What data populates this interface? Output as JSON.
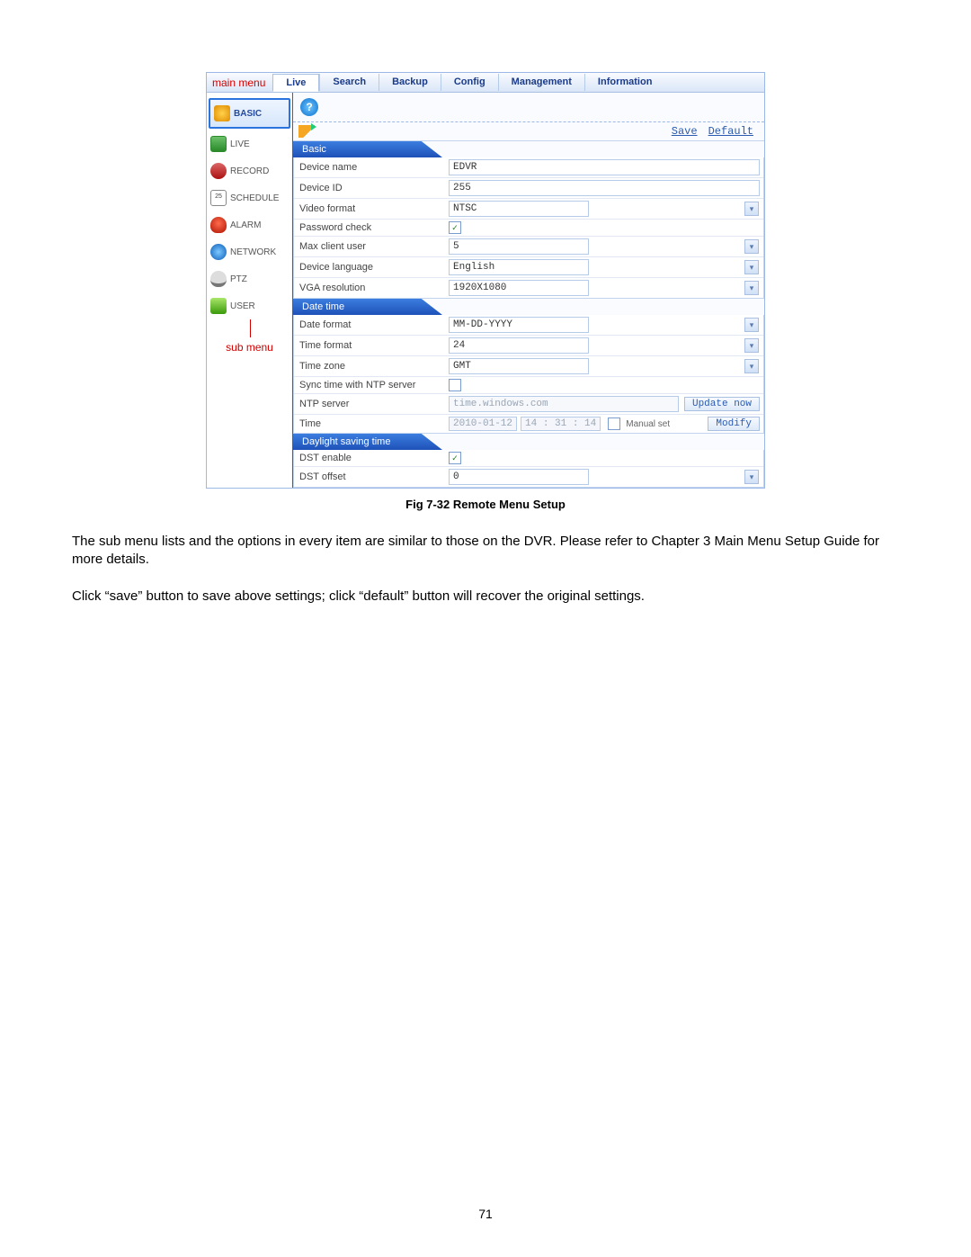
{
  "top": {
    "main_menu_label": "main menu",
    "tabs": [
      "Live",
      "Search",
      "Backup",
      "Config",
      "Management",
      "Information"
    ]
  },
  "side": {
    "items": [
      "BASIC",
      "LIVE",
      "RECORD",
      "SCHEDULE",
      "ALARM",
      "NETWORK",
      "PTZ",
      "USER"
    ],
    "sub_menu_label": "sub menu"
  },
  "toolbar": {
    "save": "Save",
    "default": "Default"
  },
  "help_glyph": "?",
  "sections": {
    "s1": "Basic",
    "s2": "Date time",
    "s3": "Daylight saving time"
  },
  "labels": {
    "device_name": "Device name",
    "device_id": "Device ID",
    "video_fmt": "Video format",
    "pw_check": "Password check",
    "max_client": "Max client user",
    "dev_lang": "Device language",
    "vga": "VGA resolution",
    "date_fmt": "Date format",
    "time_fmt": "Time format",
    "time_zone": "Time zone",
    "ntp_sync": "Sync time with NTP server",
    "ntp_server": "NTP server",
    "time": "Time",
    "dst_enable": "DST enable",
    "dst_offset": "DST offset",
    "manual_set": "Manual set"
  },
  "values": {
    "device_name": "EDVR",
    "device_id": "255",
    "video_fmt": "NTSC",
    "max_client": "5",
    "dev_lang": "English",
    "vga": "1920X1080",
    "date_fmt": "MM-DD-YYYY",
    "time_fmt": "24",
    "time_zone": "GMT",
    "ntp_server": "time.windows.com",
    "time_date": "2010-01-12",
    "time_time": "14 : 31 : 14",
    "dst_offset": "0"
  },
  "buttons": {
    "update_now": "Update now",
    "modify": "Modify"
  },
  "caption": "Fig 7-32 Remote Menu Setup",
  "p1": "The sub menu lists and the options in every item are similar to those on the DVR. Please refer to Chapter 3 Main Menu Setup Guide for more details.",
  "p2": "Click “save” button to save above settings; click “default” button will recover the original settings.",
  "page_number": "71"
}
